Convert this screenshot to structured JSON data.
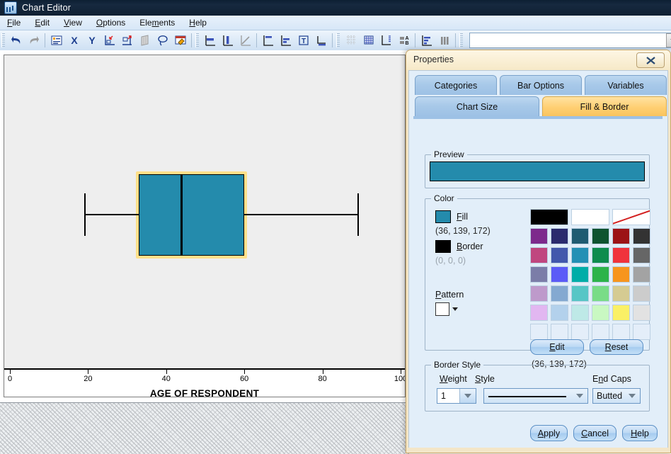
{
  "window": {
    "title": "Chart Editor",
    "icon": "chart-editor-icon"
  },
  "menubar": {
    "items": [
      {
        "label": "File",
        "mnemonic": "F"
      },
      {
        "label": "Edit",
        "mnemonic": "E"
      },
      {
        "label": "View",
        "mnemonic": "V"
      },
      {
        "label": "Options",
        "mnemonic": "O"
      },
      {
        "label": "Elements",
        "mnemonic": "m"
      },
      {
        "label": "Help",
        "mnemonic": "H"
      }
    ]
  },
  "toolbar": {
    "icons": [
      "undo-icon",
      "redo-icon",
      "show-data-labels-icon",
      "x-axis-icon",
      "y-axis-icon",
      "transpose-icon",
      "swap-axes-icon",
      "3d-rotation-icon",
      "lasso-select-icon",
      "edit-properties-icon",
      "horizontal-bar-icon",
      "vertical-bar-icon",
      "line-chart-icon",
      "area-chart-icon",
      "stacked-bar-icon",
      "text-box-icon",
      "baseline-icon",
      "grid-lines-icon",
      "grid-icon",
      "reference-line-icon",
      "sort-ab-icon",
      "distribution-icon",
      "histogram-icon"
    ],
    "combo_value": ""
  },
  "chart": {
    "axis_title": "AGE OF RESPONDENT",
    "selected_element": "box-element"
  },
  "chart_data": {
    "type": "boxplot",
    "title": "",
    "xlabel": "AGE OF RESPONDENT",
    "ylabel": "",
    "xlim": [
      0,
      100
    ],
    "xticks": [
      0,
      20,
      40,
      60,
      80,
      100
    ],
    "xticklabels": [
      "0",
      "20",
      "40",
      "60",
      "80",
      "100"
    ],
    "grid": false,
    "legend": "none",
    "orientation": "horizontal",
    "boxes": [
      {
        "name": "AGE OF RESPONDENT",
        "whisker_low": 19,
        "q1": 33,
        "median": 44,
        "q3": 60,
        "whisker_high": 89,
        "outliers": [],
        "fill_color": "#248BAC",
        "border_color": "#000000",
        "selected": true
      }
    ]
  },
  "dialog": {
    "title": "Properties",
    "close_icon": "close-icon",
    "tabs_row1": [
      {
        "label": "Categories",
        "active": false
      },
      {
        "label": "Bar Options",
        "active": false
      },
      {
        "label": "Variables",
        "active": false
      }
    ],
    "tabs_row2": [
      {
        "label": "Chart Size",
        "active": false
      },
      {
        "label": "Fill & Border",
        "active": true
      }
    ],
    "preview": {
      "legend": "Preview",
      "swatch_color": "#248BAC"
    },
    "color": {
      "legend": "Color",
      "fill_label": "Fill",
      "fill_mnemonic": "F",
      "fill_rgb": "(36, 139, 172)",
      "fill_color": "#248BAC",
      "border_label": "Border",
      "border_mnemonic": "B",
      "border_rgb": "(0, 0, 0)",
      "border_color": "#000000",
      "pattern_label": "Pattern",
      "pattern_mnemonic": "P",
      "pattern_value": "solid",
      "selected_rgb": "(36, 139, 172)",
      "edit_label": "Edit",
      "reset_label": "Reset",
      "palette": [
        [
          "#000000",
          "#FFFFFF",
          "nocolor"
        ],
        [
          "#7D2A8C",
          "#2A2B6E",
          "#1F5B72",
          "#0E5330",
          "#9C1316",
          "#333333"
        ],
        [
          "#C0467F",
          "#4258AC",
          "#2390B5",
          "#0E8C4E",
          "#F0333C",
          "#666666"
        ],
        [
          "#7B7DA8",
          "#5B5BF7",
          "#00ADA8",
          "#2DB34A",
          "#F7951E",
          "#A3A3A3"
        ],
        [
          "#BE9ACB",
          "#84A9D1",
          "#57C6C6",
          "#79DC87",
          "#D5CB92",
          "#CCCCCC"
        ],
        [
          "#E2B7F1",
          "#B3D1EC",
          "#BEE9E7",
          "#C9F8C2",
          "#FAF065",
          "#E2E2E2"
        ],
        [
          "#E4EEF9",
          "#E4EEF9",
          "#E4EEF9",
          "#E4EEF9",
          "#E4EEF9",
          "#E4EEF9"
        ]
      ]
    },
    "border_style": {
      "legend": "Border Style",
      "weight_label": "Weight",
      "weight_mnemonic": "W",
      "weight_value": "1",
      "style_label": "Style",
      "style_mnemonic": "S",
      "style_value": "solid-line",
      "endcaps_label": "End Caps",
      "endcaps_mnemonic": "n",
      "endcaps_value": "Butted"
    },
    "buttons": [
      {
        "label": "Apply",
        "mnemonic": "A",
        "name": "apply-button"
      },
      {
        "label": "Cancel",
        "mnemonic": "C",
        "name": "cancel-button"
      },
      {
        "label": "Help",
        "mnemonic": "H",
        "name": "help-button"
      }
    ]
  }
}
